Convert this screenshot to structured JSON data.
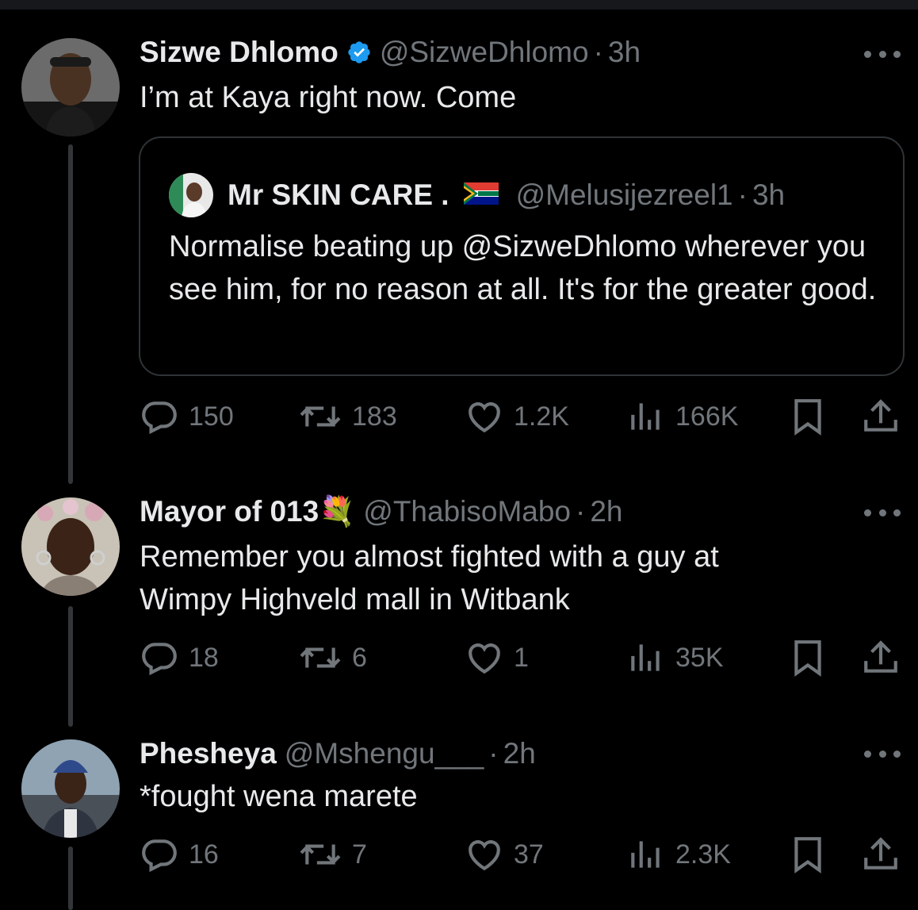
{
  "tweets": [
    {
      "name": "Sizwe Dhlomo",
      "handle": "@SizweDhlomo",
      "time": "3h",
      "verified": true,
      "text": "I’m at Kaya right now. Come",
      "quote": {
        "name": "Mr SKIN CARE .",
        "handle": "@Melusijezreel1",
        "time": "3h",
        "text": "Normalise beating up @SizweDhlomo wherever you see him, for no reason at all. It's for the greater good."
      },
      "stats": {
        "replies": "150",
        "retweets": "183",
        "likes": "1.2K",
        "views": "166K"
      }
    },
    {
      "name": "Mayor of 013💐",
      "handle": "@ThabisoMabo",
      "time": "2h",
      "text": "Remember you almost fighted with a guy at\nWimpy Highveld mall in Witbank",
      "stats": {
        "replies": "18",
        "retweets": "6",
        "likes": "1",
        "views": "35K"
      }
    },
    {
      "name": "Phesheya",
      "handle": "@Mshengu___",
      "time": "2h",
      "text": "*fought wena marete",
      "stats": {
        "replies": "16",
        "retweets": "7",
        "likes": "37",
        "views": "2.3K"
      }
    }
  ],
  "colors": {
    "background": "#000000",
    "text": "#e7e9ea",
    "muted": "#71767b",
    "verified": "#1d9bf0",
    "border": "#2f3336"
  },
  "icons": [
    "verified-badge-icon",
    "more-icon",
    "reply-icon",
    "retweet-icon",
    "like-icon",
    "views-icon",
    "bookmark-icon",
    "share-icon",
    "south-africa-flag-icon"
  ]
}
